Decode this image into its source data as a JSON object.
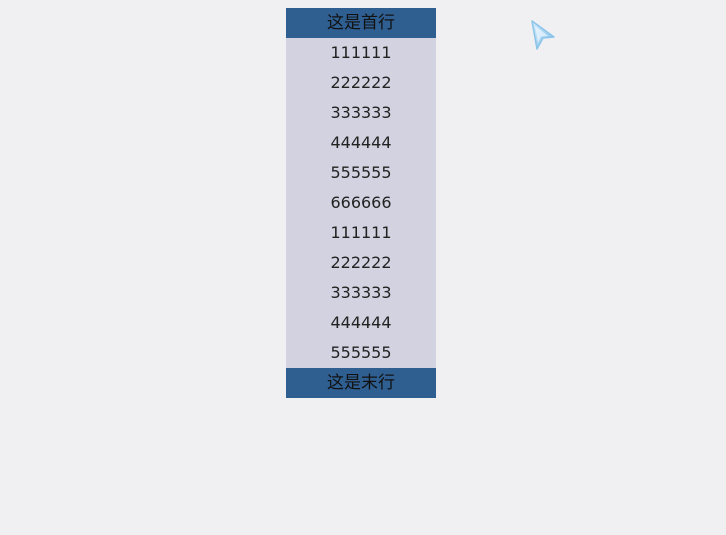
{
  "colors": {
    "background": "#f0f0f2",
    "header_footer": "#2f5e91",
    "list_body": "#d2d2e0",
    "cursor": "#9ecdf0"
  },
  "list": {
    "header": "这是首行",
    "items": [
      "111111",
      "222222",
      "333333",
      "444444",
      "555555",
      "666666",
      "111111",
      "222222",
      "333333",
      "444444",
      "555555"
    ],
    "footer": "这是末行"
  },
  "cursor": {
    "icon": "cursor-pointer-icon"
  }
}
